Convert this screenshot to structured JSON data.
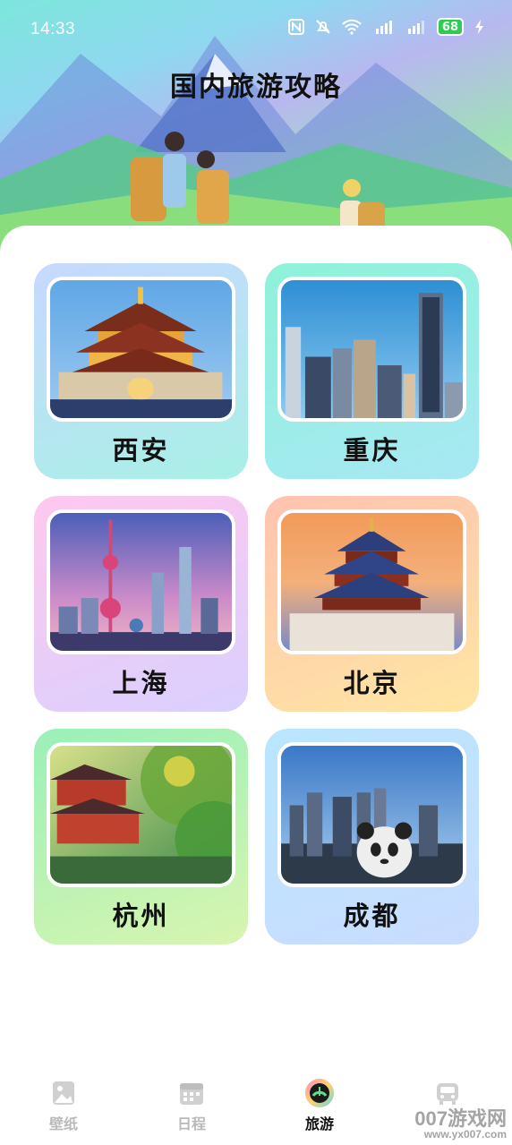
{
  "status_bar": {
    "time": "14:33",
    "battery": "68",
    "icons": [
      "nfc-icon",
      "mute-icon",
      "wifi-icon",
      "signal-5g-icon",
      "signal-5g-icon",
      "battery-icon",
      "charging-icon"
    ]
  },
  "header": {
    "title": "国内旅游攻略"
  },
  "cities": [
    {
      "name": "西安",
      "card_gradient": [
        "#c7d8ff",
        "#a8f0e6"
      ]
    },
    {
      "name": "重庆",
      "card_gradient": [
        "#8ef2d8",
        "#a8e8f4"
      ]
    },
    {
      "name": "上海",
      "card_gradient": [
        "#ffc8ee",
        "#d9d0ff"
      ]
    },
    {
      "name": "北京",
      "card_gradient": [
        "#ffc3b0",
        "#ffe6a3"
      ]
    },
    {
      "name": "杭州",
      "card_gradient": [
        "#9af0b8",
        "#d8f5b0"
      ]
    },
    {
      "name": "成都",
      "card_gradient": [
        "#b9e6ff",
        "#c9dcff"
      ]
    }
  ],
  "tabbar": {
    "tabs": [
      {
        "label": "壁纸",
        "icon": "image-icon",
        "active": false
      },
      {
        "label": "日程",
        "icon": "calendar-icon",
        "active": false
      },
      {
        "label": "旅游",
        "icon": "travel-icon",
        "active": true
      },
      {
        "label": "",
        "icon": "car-icon",
        "active": false
      }
    ]
  },
  "watermark": {
    "text": "007游戏网",
    "url": "www.yx007.com"
  },
  "colors": {
    "active_tab": "#111111",
    "inactive_tab": "#b9b9b9",
    "battery_fill": "#2ecc52"
  }
}
